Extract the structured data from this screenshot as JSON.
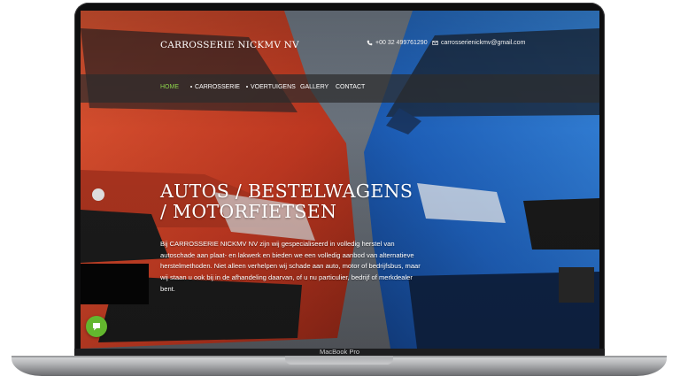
{
  "device": {
    "label": "MacBook Pro"
  },
  "header": {
    "brand": "CARROSSERIE NICKMV NV",
    "phone": "+00 32 499761290",
    "email": "carrosserienickmv@gmail.com",
    "phone_icon": "phone-icon",
    "email_icon": "envelope-icon"
  },
  "nav": {
    "items": [
      {
        "label": "HOME",
        "active": true
      },
      {
        "label": "CARROSSERIE",
        "has_dropdown": true
      },
      {
        "label": "VOERTUIGENS",
        "has_dropdown": true
      },
      {
        "label": "GALLERY"
      },
      {
        "label": "CONTACT"
      }
    ]
  },
  "hero": {
    "title": "AUTOS / BESTELWAGENS / MOTORFIETSEN",
    "text": "Bij CARROSSERIE NICKMV NV zijn wij gespecialiseerd in volledig herstel van autoschade aan plaat- en lakwerk en bieden we een volledig aanbod van alternatieve herstelmethoden. Niet alleen verhelpen wij schade aan auto, motor of bedrijfsbus, maar wij staan u ook bij in de afhandeling daarvan, of u nu particulier, bedrijf of merkdealer bent."
  },
  "chat": {
    "icon": "chat-bubble-icon"
  },
  "colors": {
    "accent": "#8bd04b",
    "chat_button": "#63b72e",
    "nav_bar": "#2d2d2d",
    "red_car": "#d4452a",
    "blue_car": "#2a6fc8"
  }
}
